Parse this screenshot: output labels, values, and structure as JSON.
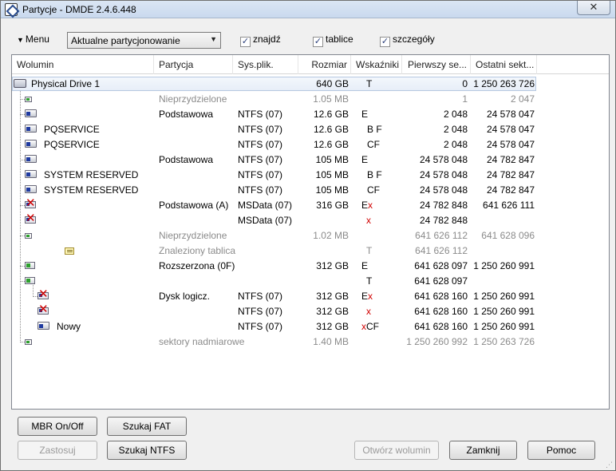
{
  "window": {
    "title": "Partycje - DMDE 2.4.6.448",
    "close_label": "✕"
  },
  "toolbar": {
    "menu_label": "Menu",
    "mode_select_value": "Aktualne partycjonowanie",
    "checkboxes": [
      {
        "label": "znajdź",
        "checked": true
      },
      {
        "label": "tablice",
        "checked": true
      },
      {
        "label": "szczegóły",
        "checked": true
      }
    ]
  },
  "columns": [
    "Wolumin",
    "Partycja",
    "Sys.plik.",
    "Rozmiar",
    "Wskaźniki",
    "Pierwszy se...",
    "Ostatni sekt..."
  ],
  "rows": [
    {
      "volume": "Physical Drive 1",
      "partition": "",
      "fs": "",
      "size": "640 GB",
      "flags": "T",
      "flags_red": "",
      "first": "0",
      "last": "1 250 263 726",
      "gray": false
    },
    {
      "volume": "",
      "partition": "Nieprzydzielone",
      "fs": "",
      "size": "1.05 MB",
      "flags": "",
      "flags_red": "",
      "first": "1",
      "last": "2 047",
      "gray": true
    },
    {
      "volume": "",
      "partition": "Podstawowa",
      "fs": "NTFS (07)",
      "size": "12.6 GB",
      "flags": "E",
      "flags_red": "",
      "first": "2 048",
      "last": "24 578 047",
      "gray": false
    },
    {
      "volume": "PQSERVICE",
      "partition": "",
      "fs": "NTFS (07)",
      "size": "12.6 GB",
      "flags": "B F",
      "flags_red": "",
      "first": "2 048",
      "last": "24 578 047",
      "gray": false
    },
    {
      "volume": "PQSERVICE",
      "partition": "",
      "fs": "NTFS (07)",
      "size": "12.6 GB",
      "flags": "CF",
      "flags_red": "",
      "first": "2 048",
      "last": "24 578 047",
      "gray": false
    },
    {
      "volume": "",
      "partition": "Podstawowa",
      "fs": "NTFS (07)",
      "size": "105 MB",
      "flags": "E",
      "flags_red": "",
      "first": "24 578 048",
      "last": "24 782 847",
      "gray": false
    },
    {
      "volume": "SYSTEM RESERVED",
      "partition": "",
      "fs": "NTFS (07)",
      "size": "105 MB",
      "flags": "B F",
      "flags_red": "",
      "first": "24 578 048",
      "last": "24 782 847",
      "gray": false
    },
    {
      "volume": "SYSTEM RESERVED",
      "partition": "",
      "fs": "NTFS (07)",
      "size": "105 MB",
      "flags": "CF",
      "flags_red": "",
      "first": "24 578 048",
      "last": "24 782 847",
      "gray": false
    },
    {
      "volume": "",
      "partition": "Podstawowa (A)",
      "fs": "MSData (07)",
      "size": "316 GB",
      "flags": "E",
      "flags_red": "x",
      "first": "24 782 848",
      "last": "641 626 111",
      "gray": false
    },
    {
      "volume": "",
      "partition": "",
      "fs": "MSData (07)",
      "size": "",
      "flags": "",
      "flags_red": "x",
      "first": "24 782 848",
      "last": "",
      "gray": false
    },
    {
      "volume": "",
      "partition": "Nieprzydzielone",
      "fs": "",
      "size": "1.02 MB",
      "flags": "",
      "flags_red": "",
      "first": "641 626 112",
      "last": "641 628 096",
      "gray": true
    },
    {
      "volume": "",
      "partition": "Znaleziony tablica",
      "fs": "",
      "size": "",
      "flags": "T",
      "flags_red": "",
      "first": "641 626 112",
      "last": "",
      "gray": true
    },
    {
      "volume": "",
      "partition": "Rozszerzona  (0F)",
      "fs": "",
      "size": "312 GB",
      "flags": "E",
      "flags_red": "",
      "first": "641 628 097",
      "last": "1 250 260 991",
      "gray": false
    },
    {
      "volume": "",
      "partition": "",
      "fs": "",
      "size": "",
      "flags": "T",
      "flags_red": "",
      "first": "641 628 097",
      "last": "",
      "gray": false
    },
    {
      "volume": "",
      "partition": "Dysk logicz.",
      "fs": "NTFS (07)",
      "size": "312 GB",
      "flags": "E",
      "flags_red": "x",
      "first": "641 628 160",
      "last": "1 250 260 991",
      "gray": false
    },
    {
      "volume": "",
      "partition": "",
      "fs": "NTFS (07)",
      "size": "312 GB",
      "flags": "",
      "flags_red": "x",
      "first": "641 628 160",
      "last": "1 250 260 991",
      "gray": false
    },
    {
      "volume": "Nowy",
      "partition": "",
      "fs": "NTFS (07)",
      "size": "312 GB",
      "flags": "CF",
      "flags_red": "x",
      "first": "641 628 160",
      "last": "1 250 260 991",
      "gray": false
    },
    {
      "volume": "",
      "partition": "sektory nadmiarowe",
      "fs": "",
      "size": "1.40 MB",
      "flags": "",
      "flags_red": "",
      "first": "1 250 260 992",
      "last": "1 250 263 726",
      "gray": true
    }
  ],
  "buttons": {
    "mbr": "MBR On/Off",
    "fat": "Szukaj FAT",
    "apply": "Zastosuj",
    "ntfs": "Szukaj NTFS",
    "open_volume": "Otwórz wolumin",
    "close": "Zamknij",
    "help": "Pomoc"
  }
}
